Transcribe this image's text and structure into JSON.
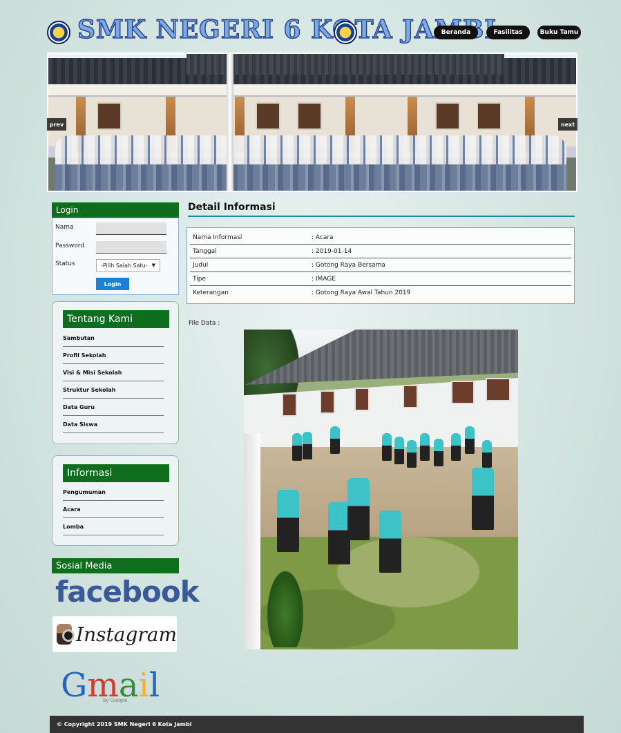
{
  "header": {
    "site_title": "SMK NEGERI 6 KOTA JAMBI",
    "nav": [
      {
        "label": "Beranda"
      },
      {
        "label": "Fasilitas"
      },
      {
        "label": "Buku Tamu"
      }
    ]
  },
  "slider": {
    "prev_label": "prev",
    "next_label": "next"
  },
  "login": {
    "title": "Login",
    "nama_label": "Nama",
    "password_label": "Password",
    "status_label": "Status",
    "status_selected": "-Pilih Salah Satu-",
    "button_label": "Login"
  },
  "tentang": {
    "title": "Tentang Kami",
    "items": [
      {
        "label": "Sambutan"
      },
      {
        "label": "Profil Sekolah"
      },
      {
        "label": "Visi & Misi Sekolah"
      },
      {
        "label": "Struktur Sekolah"
      },
      {
        "label": "Data Guru"
      },
      {
        "label": "Data Siswa"
      }
    ]
  },
  "informasi": {
    "title": "Informasi",
    "items": [
      {
        "label": "Pengumuman"
      },
      {
        "label": "Acara"
      },
      {
        "label": "Lomba"
      }
    ]
  },
  "social": {
    "title": "Sosial Media",
    "facebook_text": "facebook",
    "instagram_text": "Instagram",
    "gmail_text": "Gmail",
    "gmail_sub": "by Google"
  },
  "main": {
    "title": "Detail Informasi",
    "rows": [
      {
        "key": "Nama Informasi",
        "value": ": Acara"
      },
      {
        "key": "Tanggal",
        "value": ": 2019-01-14"
      },
      {
        "key": "Judul",
        "value": ": Gotong Raya Bersama"
      },
      {
        "key": "Tipe",
        "value": ": IMAGE"
      },
      {
        "key": "Keterangan",
        "value": ": Gotong Raya Awal Tahun 2019"
      }
    ],
    "file_label": "File Data :"
  },
  "footer": {
    "text": "© Copyright 2019 SMK Negeri 6 Kota Jambi"
  }
}
